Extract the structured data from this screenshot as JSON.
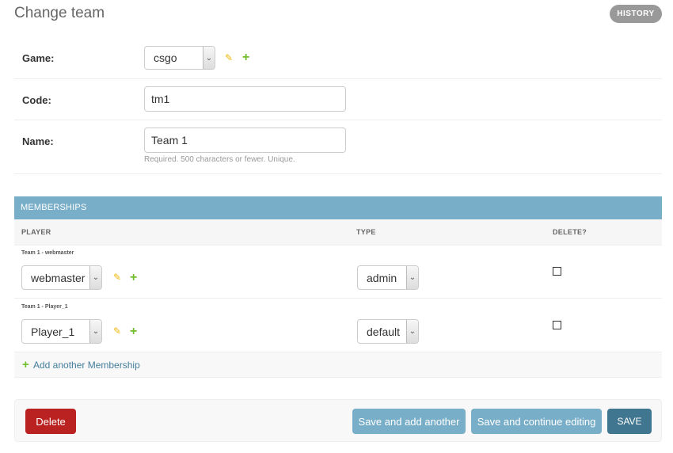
{
  "header": {
    "title": "Change team",
    "history_label": "HISTORY"
  },
  "fields": {
    "game": {
      "label": "Game:",
      "value": "csgo"
    },
    "code": {
      "label": "Code:",
      "value": "tm1"
    },
    "name": {
      "label": "Name:",
      "value": "Team 1",
      "help": "Required. 500 characters or fewer. Unique."
    }
  },
  "memberships": {
    "caption": "MEMBERSHIPS",
    "columns": {
      "player": "PLAYER",
      "type": "TYPE",
      "delete": "DELETE?"
    },
    "rows": [
      {
        "original": "Team 1 - webmaster",
        "player": "webmaster",
        "type": "admin"
      },
      {
        "original": "Team 1 - Player_1",
        "player": "Player_1",
        "type": "default"
      }
    ],
    "add_label": "Add another Membership"
  },
  "actions": {
    "delete": "Delete",
    "save_add_another": "Save and add another",
    "save_continue": "Save and continue editing",
    "save": "SAVE"
  },
  "icons": {
    "edit": "pencil-icon",
    "add": "plus-icon",
    "dropdown": "chevron-down-icon"
  },
  "colors": {
    "caption_bg": "#79aec8",
    "delete": "#ba2121",
    "save": "#417690",
    "add_icon": "#70bf2b",
    "edit_icon": "#efb80b"
  }
}
